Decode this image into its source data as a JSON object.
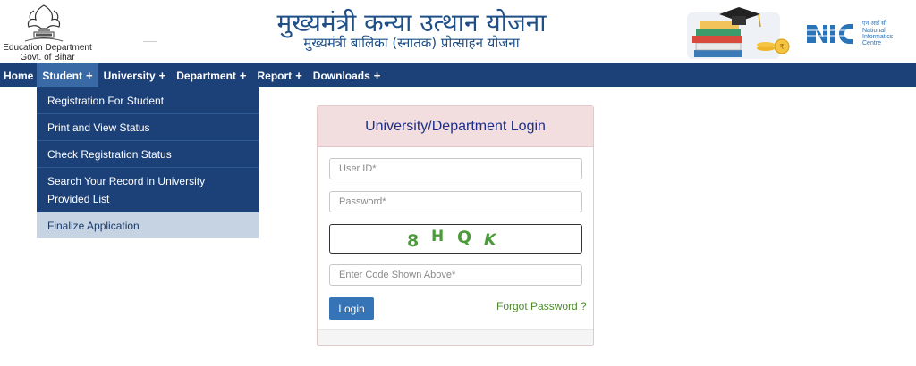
{
  "header": {
    "dept_line1": "Education Department",
    "dept_line2": "Govt. of Bihar",
    "title_main": "मुख्यमंत्री कन्या उत्थान योजना",
    "title_sub": "मुख्यमंत्री बालिका (स्नातक) प्रोत्साहन योजना",
    "nic_hindi": "एन आई सी",
    "nic_line1": "National",
    "nic_line2": "Informatics",
    "nic_line3": "Centre",
    "nic_short": "NIC"
  },
  "nav": {
    "items": [
      {
        "label": "Home",
        "plus": ""
      },
      {
        "label": "Student",
        "plus": "+"
      },
      {
        "label": "University",
        "plus": "+"
      },
      {
        "label": "Department",
        "plus": "+"
      },
      {
        "label": "Report",
        "plus": "+"
      },
      {
        "label": "Downloads",
        "plus": "+"
      }
    ]
  },
  "dropdown": {
    "items": [
      {
        "label": "Registration For Student"
      },
      {
        "label": "Print and View Status"
      },
      {
        "label": "Check Registration Status"
      },
      {
        "label": "Search Your Record in University Provided List"
      },
      {
        "label": "Finalize Application"
      }
    ]
  },
  "login": {
    "title": "University/Department Login",
    "userid_placeholder": "User ID*",
    "password_placeholder": "Password*",
    "captcha_chars": [
      "8",
      "H",
      "Q",
      "K"
    ],
    "code_placeholder": "Enter Code Shown Above*",
    "login_label": "Login",
    "forgot_label": "Forgot Password ?"
  },
  "colors": {
    "nav_bg": "#1c4179",
    "nav_active": "#3a6aa6",
    "panel_head_bg": "#f2dede",
    "title_blue": "#1f4f87",
    "captcha_green": "#4b9b3a",
    "button_blue": "#3574b6",
    "link_green": "#4b8a2a"
  },
  "icons": {
    "emblem": "ashoka-emblem-icon",
    "books": "books-graduation-icon",
    "nic": "nic-logo-icon"
  }
}
